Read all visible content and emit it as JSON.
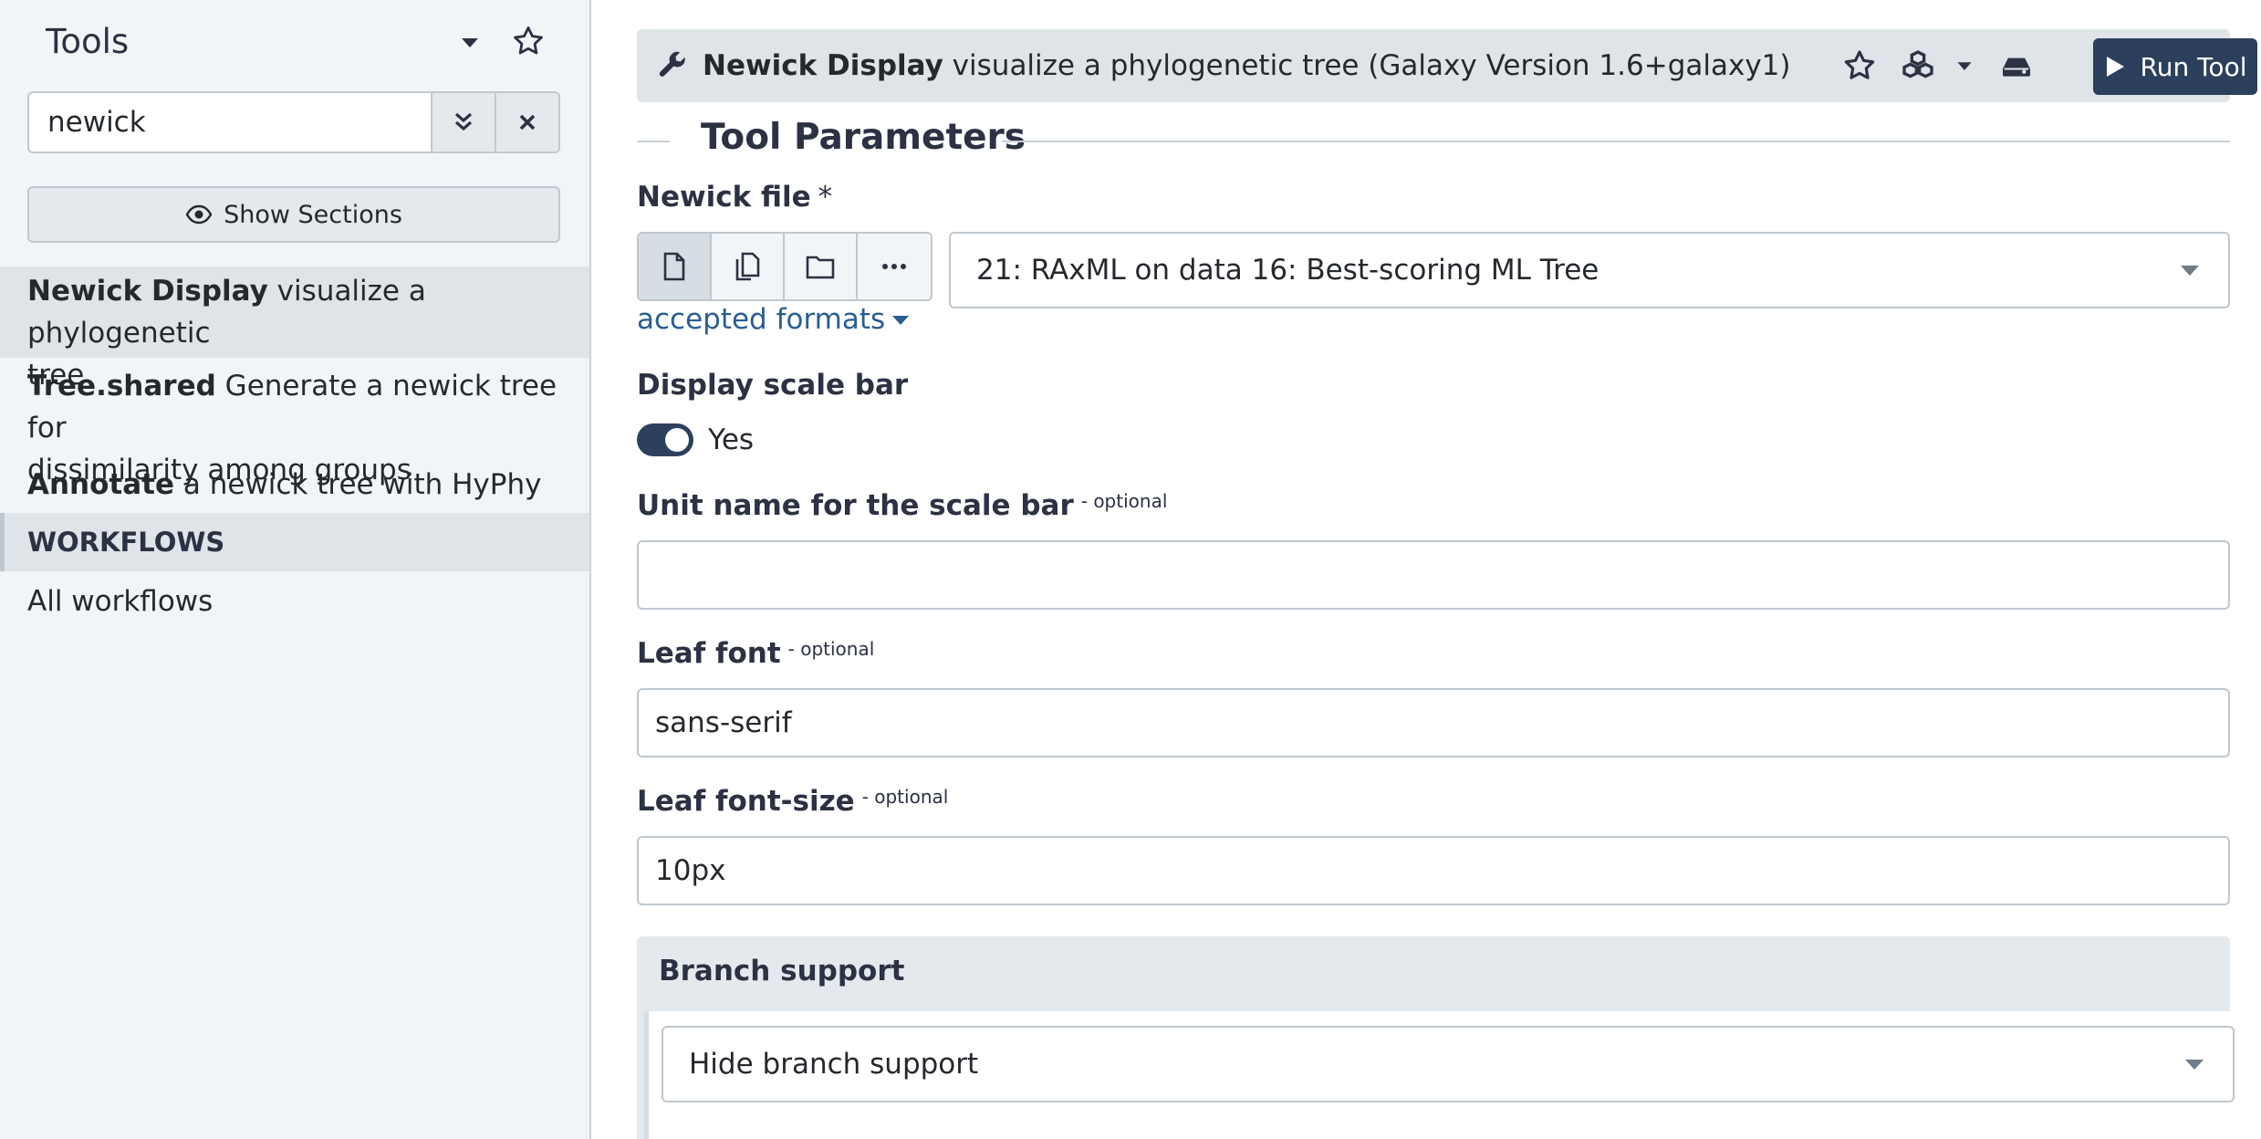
{
  "sidebar": {
    "title": "Tools",
    "search_value": "newick",
    "show_sections_label": "Show Sections",
    "tools": [
      {
        "name": "Newick Display",
        "desc_line1": " visualize a phylogenetic",
        "desc_line2": "tree"
      },
      {
        "name": "Tree.shared",
        "desc_line1": " Generate a newick tree for",
        "desc_line2": "dissimilarity among groups"
      },
      {
        "name": "Annotate",
        "desc_line1": " a newick tree with HyPhy"
      }
    ],
    "workflows_header": "WORKFLOWS",
    "all_workflows": "All workflows"
  },
  "toolbar": {
    "tool_name": "Newick Display",
    "tool_desc": " visualize a phylogenetic tree (Galaxy Version 1.6+galaxy1)",
    "run_label": "Run Tool"
  },
  "form": {
    "section_title": "Tool Parameters",
    "newick_file": {
      "label": "Newick file",
      "required_mark": "*",
      "selected": "21: RAxML on data 16: Best-scoring ML Tree",
      "accepted_formats": "accepted formats"
    },
    "scale_bar": {
      "label": "Display scale bar",
      "value": "Yes",
      "on": true
    },
    "unit_name": {
      "label": "Unit name for the scale bar",
      "optional": "- optional",
      "value": ""
    },
    "leaf_font": {
      "label": "Leaf font",
      "optional": "- optional",
      "value": "sans-serif"
    },
    "leaf_font_size": {
      "label": "Leaf font-size",
      "optional": "- optional",
      "value": "10px"
    },
    "branch_support": {
      "title": "Branch support",
      "selected": "Hide branch support"
    }
  },
  "colors": {
    "sidebar_bg": "#f2f5f7",
    "accent_dark": "#2c3f5c",
    "link": "#2b5e91",
    "panel_bg": "#dfe4e8"
  }
}
